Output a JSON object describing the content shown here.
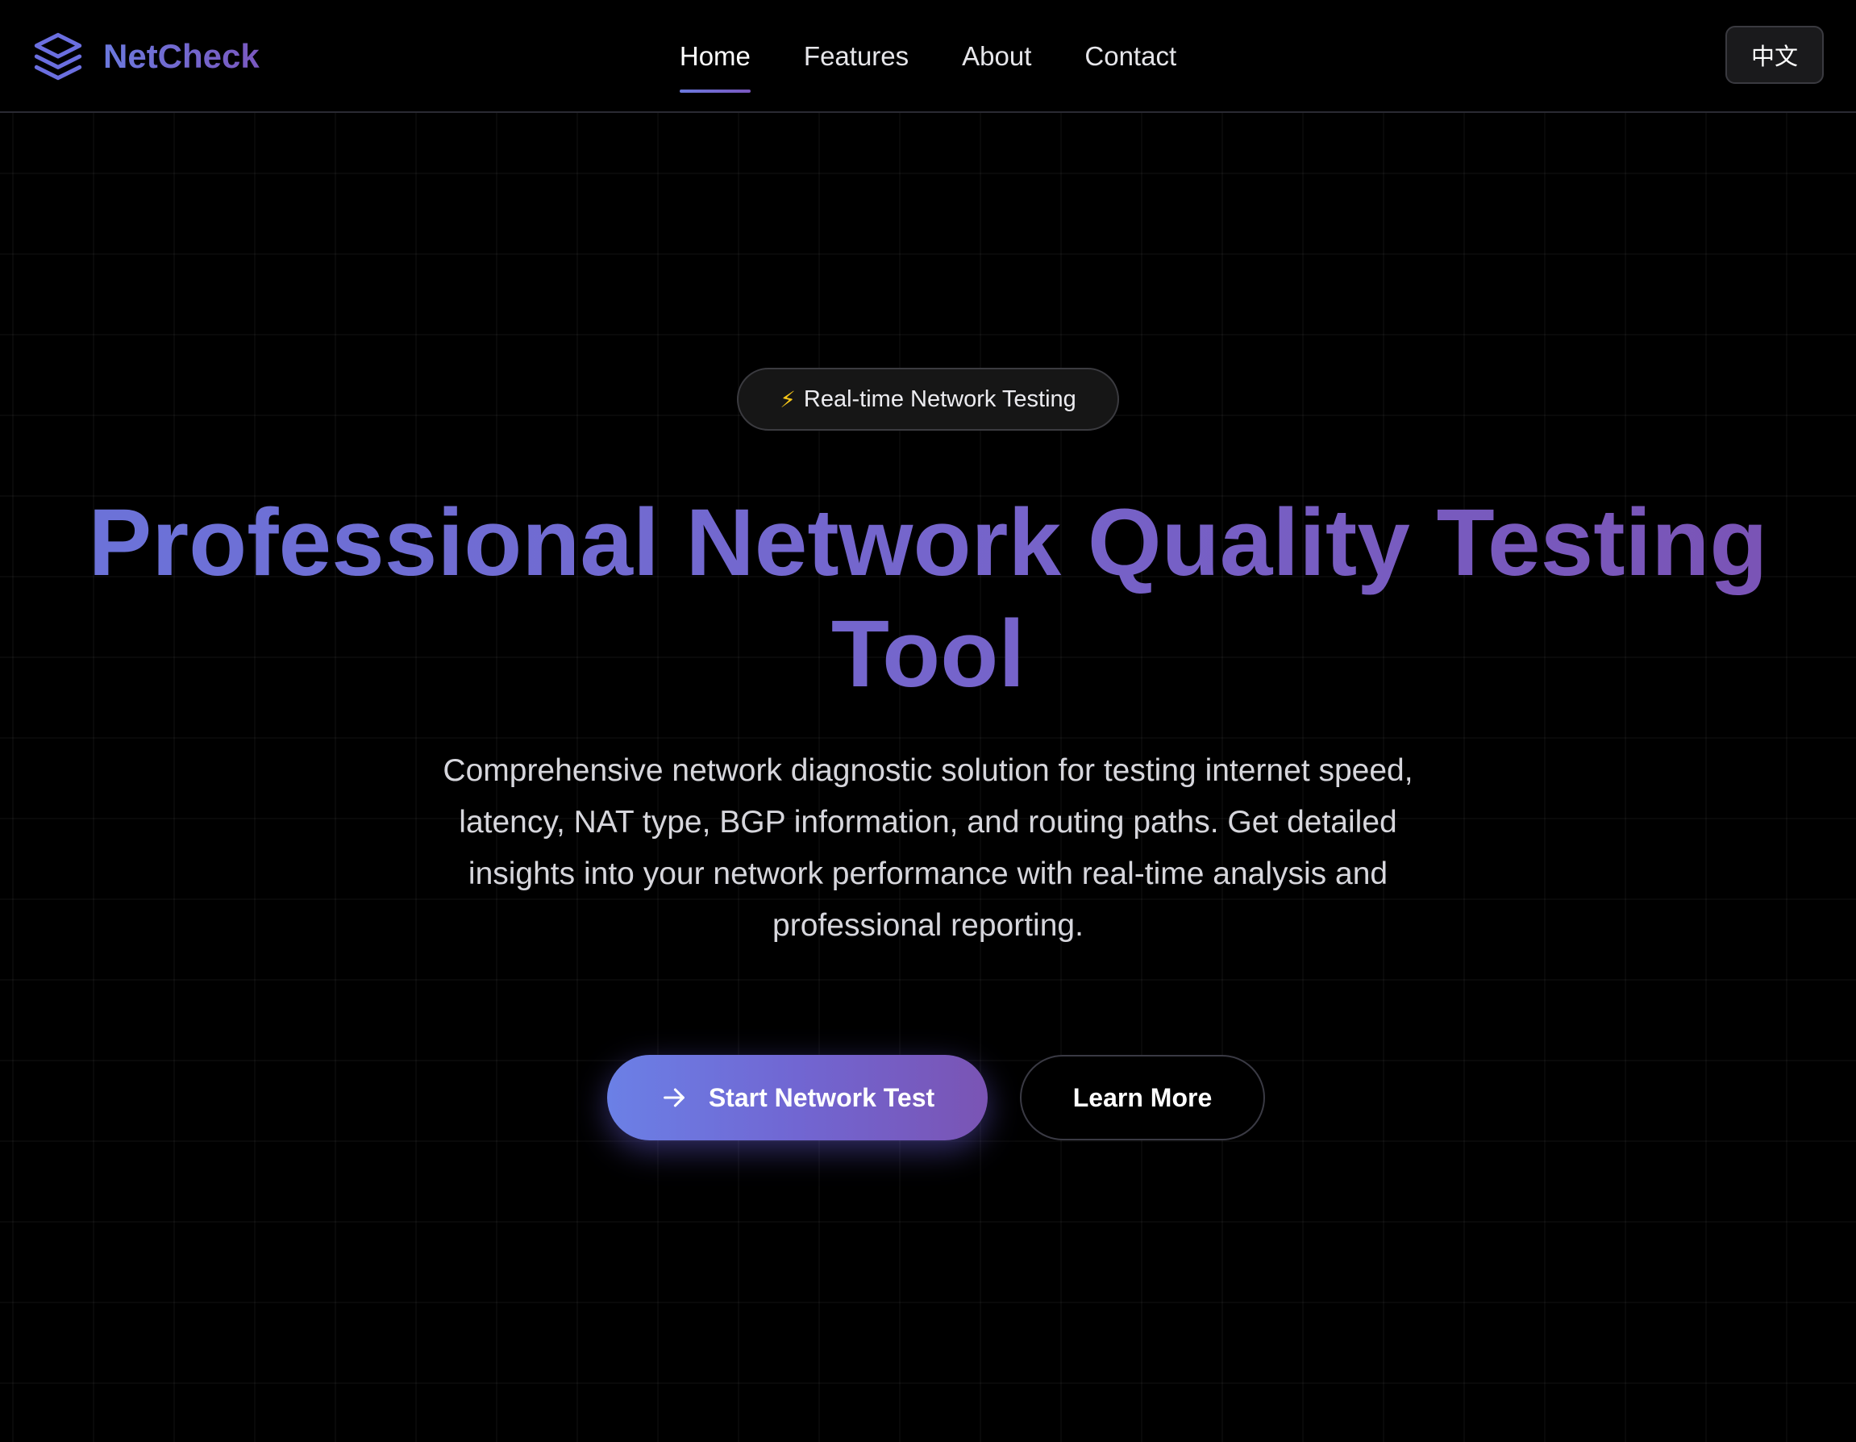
{
  "header": {
    "brand": "NetCheck",
    "logo_icon": "layers-icon",
    "nav": [
      {
        "label": "Home",
        "active": true
      },
      {
        "label": "Features",
        "active": false
      },
      {
        "label": "About",
        "active": false
      },
      {
        "label": "Contact",
        "active": false
      }
    ],
    "language_button": "中文"
  },
  "hero": {
    "badge_icon": "⚡",
    "badge_text": "Real-time Network Testing",
    "title_line1": "Professional Network Quality Testing",
    "title_line2": "Tool",
    "description": "Comprehensive network diagnostic solution for testing internet speed, latency, NAT type, BGP information, and routing paths. Get detailed insights into your network performance with real-time analysis and professional reporting.",
    "primary_button": "Start Network Test",
    "primary_button_icon": "arrow-right-icon",
    "secondary_button": "Learn More"
  },
  "colors": {
    "background": "#000000",
    "accent_start": "#6b80e6",
    "accent_end": "#7a54b4",
    "badge_icon": "#f5c518"
  }
}
